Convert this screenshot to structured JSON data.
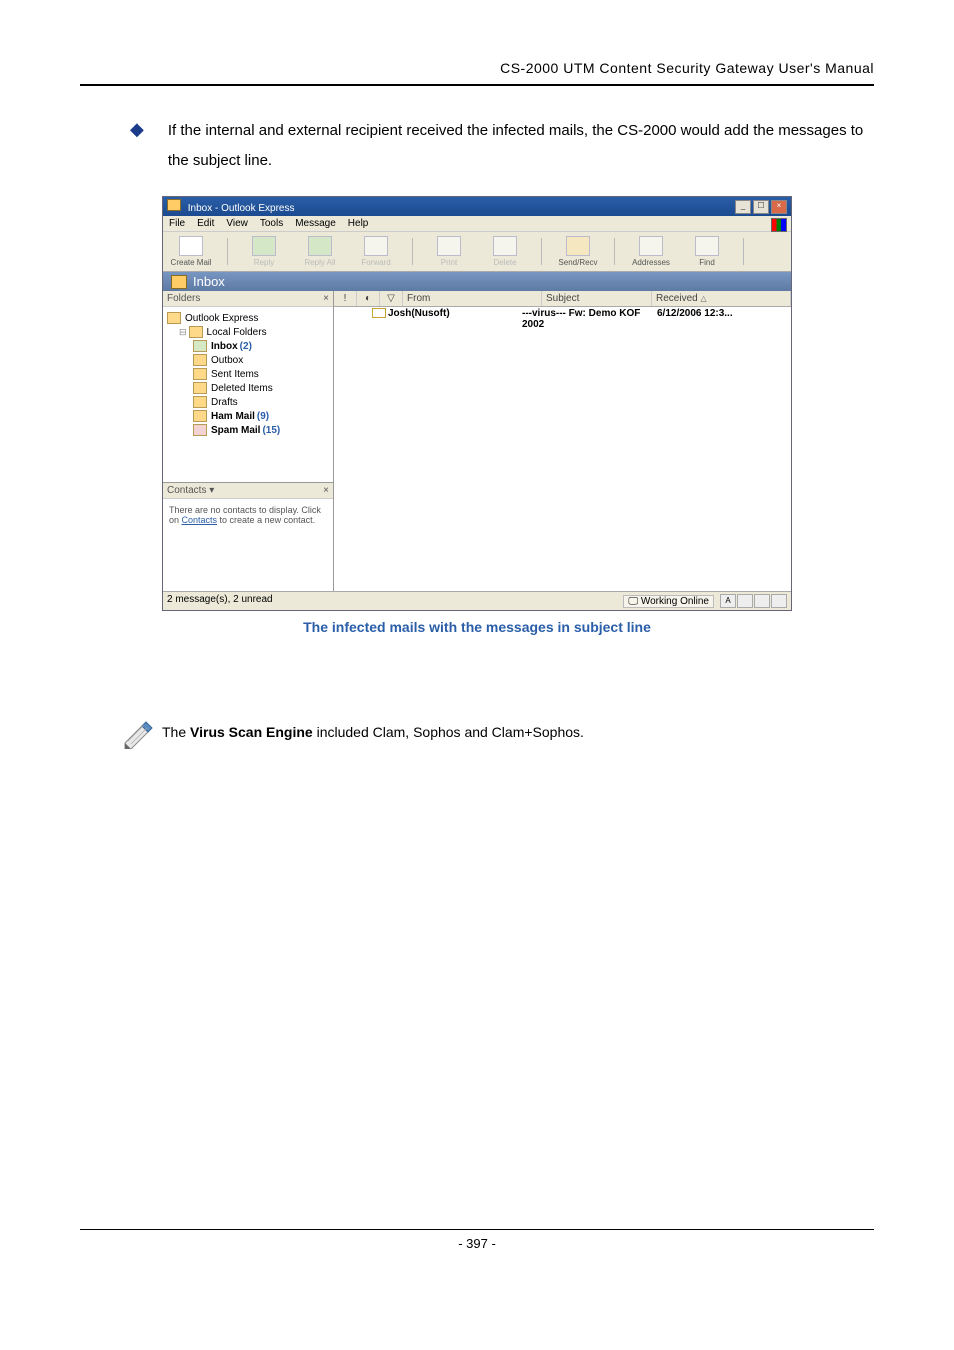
{
  "header": {
    "title": "CS-2000 UTM Content Security Gateway User's Manual"
  },
  "intro": {
    "text": "If the internal and external recipient received the infected mails, the CS-2000 would add the messages to the subject line."
  },
  "oe": {
    "title": "Inbox - Outlook Express",
    "menu": [
      "File",
      "Edit",
      "View",
      "Tools",
      "Message",
      "Help"
    ],
    "toolbar": [
      {
        "label": "Create Mail",
        "enabled": true
      },
      {
        "label": "Reply",
        "enabled": false
      },
      {
        "label": "Reply All",
        "enabled": false
      },
      {
        "label": "Forward",
        "enabled": false
      },
      {
        "label": "Print",
        "enabled": false
      },
      {
        "label": "Delete",
        "enabled": false
      },
      {
        "label": "Send/Recv",
        "enabled": true
      },
      {
        "label": "Addresses",
        "enabled": true
      },
      {
        "label": "Find",
        "enabled": true
      }
    ],
    "viewbar": "Inbox",
    "folders_header": "Folders",
    "folders": [
      {
        "name": "Outlook Express",
        "indent": 0
      },
      {
        "name": "Local Folders",
        "indent": 1,
        "expand": "−"
      },
      {
        "name": "Inbox",
        "count": "(2)",
        "indent": 2,
        "bold": true
      },
      {
        "name": "Outbox",
        "indent": 2
      },
      {
        "name": "Sent Items",
        "indent": 2
      },
      {
        "name": "Deleted Items",
        "indent": 2
      },
      {
        "name": "Drafts",
        "indent": 2
      },
      {
        "name": "Ham Mail",
        "count": "(9)",
        "indent": 2,
        "bold": true
      },
      {
        "name": "Spam Mail",
        "count": "(15)",
        "indent": 2,
        "bold": true
      }
    ],
    "contacts_header": "Contacts ▾",
    "contacts_body_pre": "There are no contacts to display. Click on ",
    "contacts_body_link": "Contacts",
    "contacts_body_post": " to create a new contact.",
    "list_headers": {
      "priority": "!",
      "attach": "📎",
      "flag": "▽",
      "from": "From",
      "subject": "Subject",
      "received": "Received"
    },
    "rows": [
      {
        "from": "Josh(Nusoft)",
        "subject": "---virus--- Fw: Demo KOF 2002",
        "received": "6/12/2006 12:3..."
      }
    ],
    "status_left": "2 message(s), 2 unread",
    "status_right": "Working Online",
    "ime": [
      "A",
      "",
      "",
      ""
    ]
  },
  "caption": "The infected mails with the messages in subject line",
  "note": {
    "pre": "The ",
    "bold": "Virus Scan Engine",
    "post": " included Clam, Sophos and Clam+Sophos."
  },
  "footer": "- 397 -"
}
